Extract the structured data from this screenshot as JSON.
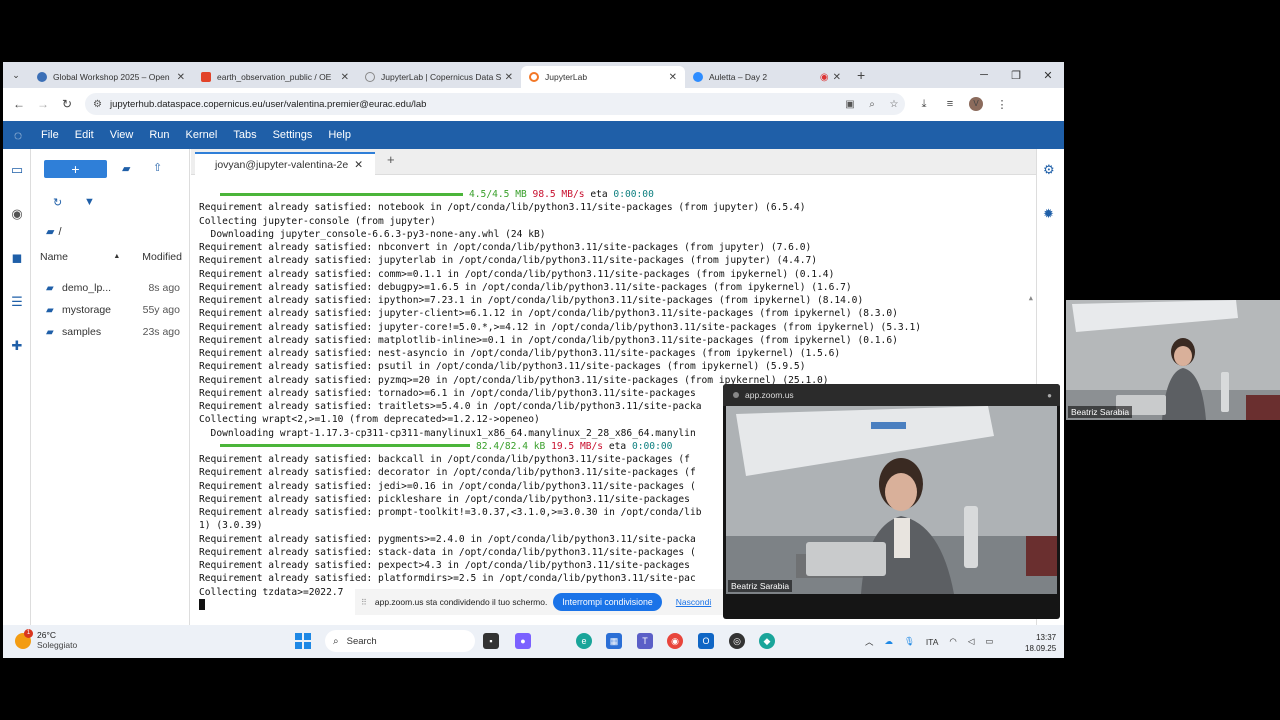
{
  "browser": {
    "tabs": [
      {
        "label": "Global Workshop 2025 – Open",
        "icon": "copernicus-icon",
        "color": "#3b6fb6"
      },
      {
        "label": "earth_observation_public / OE",
        "icon": "gitlab-icon",
        "color": "#e24329"
      },
      {
        "label": "JupyterLab | Copernicus Data S",
        "icon": "loading-icon",
        "color": "#888888"
      },
      {
        "label": "JupyterLab",
        "icon": "jupyter-icon",
        "color": "#f37726"
      },
      {
        "label": "Auletta – Day 2",
        "icon": "zoom-icon",
        "color": "#2d8cff"
      }
    ],
    "url": "jupyterhub.dataspace.copernicus.eu/user/valentina.premier@eurac.edu/lab",
    "avatar_letter": "V"
  },
  "jupyter": {
    "menu": [
      "File",
      "Edit",
      "View",
      "Run",
      "Kernel",
      "Tabs",
      "Settings",
      "Help"
    ],
    "filebrowser": {
      "path": "/",
      "col_name": "Name",
      "col_modified": "Modified",
      "files": [
        {
          "name": "demo_lp...",
          "modified": "8s ago"
        },
        {
          "name": "mystorage",
          "modified": "55y ago"
        },
        {
          "name": "samples",
          "modified": "23s ago"
        }
      ]
    },
    "terminal_tab": "jovyan@jupyter-valentina-2e",
    "terminal": {
      "progress1": {
        "size": "4.5/4.5 MB",
        "speed": "98.5 MB/s",
        "eta_label": "eta",
        "eta": "0:00:00",
        "fraction": 1.0
      },
      "lines_a": [
        "Requirement already satisfied: notebook in /opt/conda/lib/python3.11/site-packages (from jupyter) (6.5.4)",
        "Collecting jupyter-console (from jupyter)",
        "  Downloading jupyter_console-6.6.3-py3-none-any.whl (24 kB)",
        "Requirement already satisfied: nbconvert in /opt/conda/lib/python3.11/site-packages (from jupyter) (7.6.0)",
        "Requirement already satisfied: jupyterlab in /opt/conda/lib/python3.11/site-packages (from jupyter) (4.4.7)",
        "Requirement already satisfied: comm>=0.1.1 in /opt/conda/lib/python3.11/site-packages (from ipykernel) (0.1.4)",
        "Requirement already satisfied: debugpy>=1.6.5 in /opt/conda/lib/python3.11/site-packages (from ipykernel) (1.6.7)",
        "Requirement already satisfied: ipython>=7.23.1 in /opt/conda/lib/python3.11/site-packages (from ipykernel) (8.14.0)",
        "Requirement already satisfied: jupyter-client>=6.1.12 in /opt/conda/lib/python3.11/site-packages (from ipykernel) (8.3.0)",
        "Requirement already satisfied: jupyter-core!=5.0.*,>=4.12 in /opt/conda/lib/python3.11/site-packages (from ipykernel) (5.3.1)",
        "Requirement already satisfied: matplotlib-inline>=0.1 in /opt/conda/lib/python3.11/site-packages (from ipykernel) (0.1.6)",
        "Requirement already satisfied: nest-asyncio in /opt/conda/lib/python3.11/site-packages (from ipykernel) (1.5.6)",
        "Requirement already satisfied: psutil in /opt/conda/lib/python3.11/site-packages (from ipykernel) (5.9.5)",
        "Requirement already satisfied: pyzmq>=20 in /opt/conda/lib/python3.11/site-packages (from ipykernel) (25.1.0)",
        "Requirement already satisfied: tornado>=6.1 in /opt/conda/lib/python3.11/site-packages",
        "Requirement already satisfied: traitlets>=5.4.0 in /opt/conda/lib/python3.11/site-packa",
        "Collecting wrapt<2,>=1.10 (from deprecated>=1.2.12->openeo)",
        "  Downloading wrapt-1.17.3-cp311-cp311-manylinux1_x86_64.manylinux_2_28_x86_64.manylin"
      ],
      "progress2": {
        "size": "82.4/82.4 kB",
        "speed": "19.5 MB/s",
        "eta_label": "eta",
        "eta": "0:00:00",
        "fraction": 1.0
      },
      "lines_b": [
        "Requirement already satisfied: backcall in /opt/conda/lib/python3.11/site-packages (f",
        "Requirement already satisfied: decorator in /opt/conda/lib/python3.11/site-packages (f",
        "Requirement already satisfied: jedi>=0.16 in /opt/conda/lib/python3.11/site-packages (",
        "Requirement already satisfied: pickleshare in /opt/conda/lib/python3.11/site-packages",
        "Requirement already satisfied: prompt-toolkit!=3.0.37,<3.1.0,>=3.0.30 in /opt/conda/lib",
        "1) (3.0.39)",
        "Requirement already satisfied: pygments>=2.4.0 in /opt/conda/lib/python3.11/site-packa",
        "Requirement already satisfied: stack-data in /opt/conda/lib/python3.11/site-packages (",
        "Requirement already satisfied: pexpect>4.3 in /opt/conda/lib/python3.11/site-packages",
        "Requirement already satisfied: platformdirs>=2.5 in /opt/conda/lib/python3.11/site-pac",
        "Collecting tzdata>=2022.7"
      ]
    }
  },
  "share_bar": {
    "text": "app.zoom.us sta condividendo il tuo schermo.",
    "stop_label": "Interrompi condivisione",
    "hide_label": "Nascondi"
  },
  "taskbar": {
    "weather_temp": "26°C",
    "weather_desc": "Soleggiato",
    "weather_badge": "1",
    "search_placeholder": "Search",
    "lang": "ITA",
    "time": "13:37",
    "date": "18.09.25"
  },
  "zoom": {
    "window_title": "app.zoom.us",
    "main_name": "Beatriz Sarabia",
    "pip_name": "Beatriz Sarabia"
  },
  "colors": {
    "jupyter_blue": "#1f5fa8",
    "progress_green": "#4bb53a",
    "speed_red": "#c8102e",
    "eta_teal": "#0f8080"
  }
}
